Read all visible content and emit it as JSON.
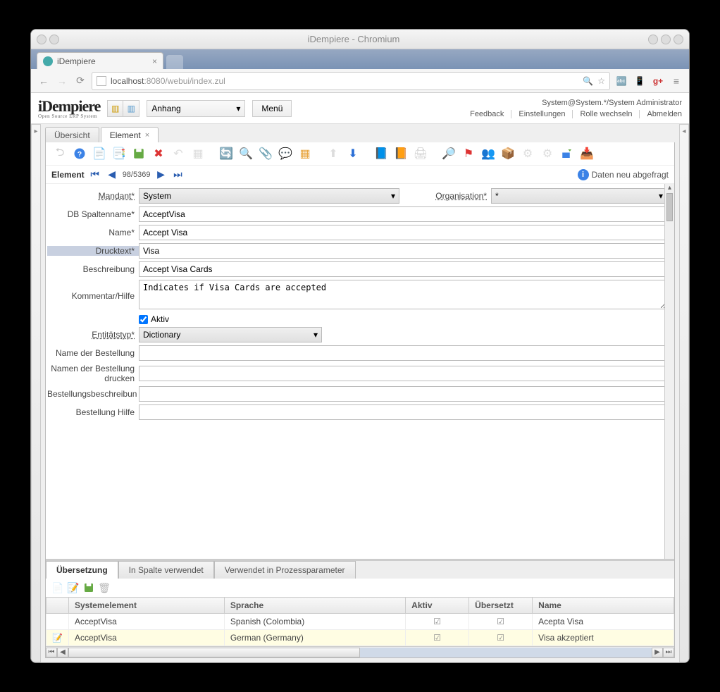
{
  "window": {
    "title": "iDempiere - Chromium"
  },
  "browser_tab": {
    "label": "iDempiere"
  },
  "url": {
    "host": "localhost",
    "port_path": ":8080/webui/index.zul"
  },
  "header": {
    "logo_main": "iDempiere",
    "logo_sub": "Open Source ERP System",
    "dropdown": "Anhang",
    "menu_btn": "Menü",
    "context": "System@System.*/System Administrator",
    "links": [
      "Feedback",
      "Einstellungen",
      "Rolle wechseln",
      "Abmelden"
    ]
  },
  "window_tabs": {
    "overview": "Übersicht",
    "element": "Element"
  },
  "recordbar": {
    "label": "Element",
    "pos": "98/5369",
    "status": "Daten neu abgefragt"
  },
  "form": {
    "mandant_label": "Mandant",
    "mandant_value": "System",
    "org_label": "Organisation",
    "org_value": "*",
    "dbcol_label": "DB Spaltenname",
    "dbcol_value": "AcceptVisa",
    "name_label": "Name",
    "name_value": "Accept Visa",
    "print_label": "Drucktext",
    "print_value": "Visa",
    "desc_label": "Beschreibung",
    "desc_value": "Accept Visa Cards",
    "help_label": "Kommentar/Hilfe",
    "help_value": "Indicates if Visa Cards are accepted",
    "active_label": "Aktiv",
    "entity_label": "Entitätstyp",
    "entity_value": "Dictionary",
    "poname_label": "Name der Bestellung",
    "poprint_label1": "Namen der Bestellung",
    "poprint_label2": "drucken",
    "podesc_label": "Bestellungsbeschreibun",
    "pohelp_label": "Bestellung Hilfe"
  },
  "detail": {
    "tabs": [
      "Übersetzung",
      "In Spalte verwendet",
      "Verwendet in Prozessparameter"
    ],
    "columns": {
      "systemelement": "Systemelement",
      "sprache": "Sprache",
      "aktiv": "Aktiv",
      "uebersetzt": "Übersetzt",
      "name": "Name"
    },
    "rows": [
      {
        "systemelement": "AcceptVisa",
        "sprache": "Spanish (Colombia)",
        "aktiv": true,
        "uebersetzt": true,
        "name": "Acepta Visa",
        "selected": false
      },
      {
        "systemelement": "AcceptVisa",
        "sprache": "German (Germany)",
        "aktiv": true,
        "uebersetzt": true,
        "name": "Visa akzeptiert",
        "selected": true
      }
    ]
  }
}
